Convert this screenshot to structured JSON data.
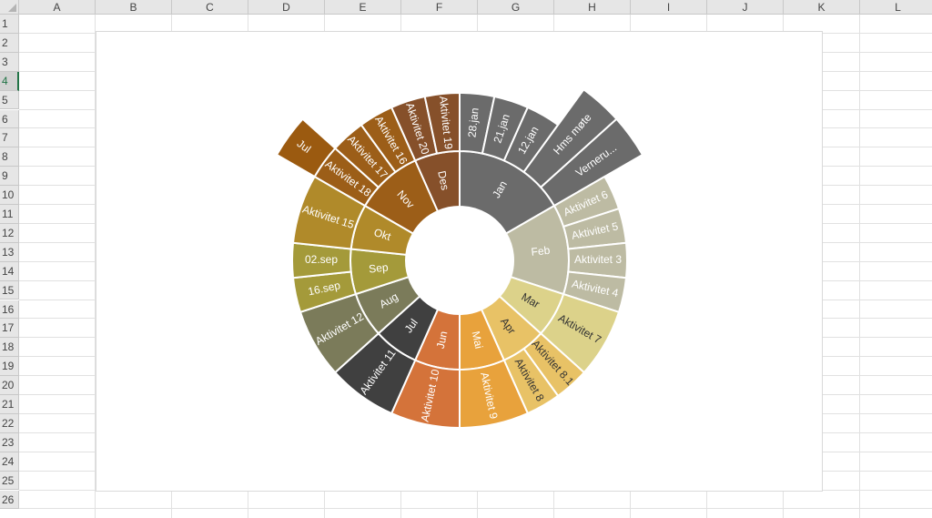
{
  "sheet": {
    "columns": [
      "A",
      "B",
      "C",
      "D",
      "E",
      "F",
      "G",
      "H",
      "I",
      "J",
      "K",
      "L"
    ],
    "rows": [
      "1",
      "2",
      "3",
      "4",
      "5",
      "6",
      "7",
      "8",
      "9",
      "10",
      "11",
      "12",
      "13",
      "14",
      "15",
      "16",
      "17",
      "18",
      "19",
      "20",
      "21",
      "22",
      "23",
      "24",
      "25",
      "26"
    ],
    "selected_row": "4"
  },
  "chart_data": {
    "type": "sunburst",
    "title": "",
    "inner": [
      {
        "label": "Jan",
        "value": 5,
        "color": "#6b6b6b"
      },
      {
        "label": "Feb",
        "value": 4,
        "color": "#bdbba3"
      },
      {
        "label": "Mar",
        "value": 2,
        "color": "#dcd28a"
      },
      {
        "label": "Apr",
        "value": 2,
        "color": "#e8c266"
      },
      {
        "label": "Mai",
        "value": 2,
        "color": "#e8a23c"
      },
      {
        "label": "Jun",
        "value": 2,
        "color": "#d4733a"
      },
      {
        "label": "Jul",
        "value": 2,
        "color": "#404040"
      },
      {
        "label": "Aug",
        "value": 2,
        "color": "#7b7b5a"
      },
      {
        "label": "Sep",
        "value": 2,
        "color": "#a49a3a"
      },
      {
        "label": "Okt",
        "value": 2,
        "color": "#b08a2a"
      },
      {
        "label": "Nov",
        "value": 3,
        "color": "#9c5e18"
      },
      {
        "label": "Des",
        "value": 2,
        "color": "#86502a"
      }
    ],
    "outer": [
      {
        "label": "28.jan",
        "value": 1,
        "color": "#6b6b6b",
        "text": "#ffffff"
      },
      {
        "label": "21.jan",
        "value": 1,
        "color": "#6b6b6b",
        "text": "#ffffff",
        "extended": true
      },
      {
        "label": "12.jan",
        "value": 1,
        "color": "#6b6b6b",
        "text": "#ffffff"
      },
      {
        "label": "Hms møte",
        "value": 1,
        "color": "#6b6b6b",
        "text": "#ffffff",
        "extended": true
      },
      {
        "label": "Verneru...",
        "value": 1,
        "color": "#6b6b6b",
        "text": "#ffffff",
        "extended": true
      },
      {
        "label": "Aktivitet 6",
        "value": 1,
        "color": "#bdbba3",
        "text": "#ffffff"
      },
      {
        "label": "Aktivitet 5",
        "value": 1,
        "color": "#bdbba3",
        "text": "#ffffff"
      },
      {
        "label": "Aktivitet 3",
        "value": 1,
        "color": "#bdbba3",
        "text": "#ffffff"
      },
      {
        "label": "Aktivitet 4",
        "value": 1,
        "color": "#bdbba3",
        "text": "#ffffff"
      },
      {
        "label": "Aktivitet 7",
        "value": 2,
        "color": "#dcd28a",
        "text": "#333333"
      },
      {
        "label": "Aktivitet 8.1",
        "value": 1,
        "color": "#e8c266",
        "text": "#333333"
      },
      {
        "label": "Aktivitet 8",
        "value": 1,
        "color": "#e8c266",
        "text": "#333333"
      },
      {
        "label": "Aktivitet 9",
        "value": 2,
        "color": "#e8a23c",
        "text": "#ffffff"
      },
      {
        "label": "Aktivitet 10",
        "value": 2,
        "color": "#d4733a",
        "text": "#ffffff"
      },
      {
        "label": "Aktivitet 11",
        "value": 2,
        "color": "#404040",
        "text": "#ffffff"
      },
      {
        "label": "Aktivitet 12",
        "value": 2,
        "color": "#7b7b5a",
        "text": "#ffffff"
      },
      {
        "label": "16.sep",
        "value": 1,
        "color": "#a49a3a",
        "text": "#ffffff"
      },
      {
        "label": "02.sep",
        "value": 1,
        "color": "#a49a3a",
        "text": "#ffffff"
      },
      {
        "label": "Aktivitet 15",
        "value": 2,
        "color": "#b08a2a",
        "text": "#ffffff"
      },
      {
        "label": "Aktivitet 18",
        "value": 1,
        "color": "#9c5e18",
        "text": "#ffffff",
        "child": "Jul"
      },
      {
        "label": "Aktivitet 17",
        "value": 1,
        "color": "#9c5e18",
        "text": "#ffffff"
      },
      {
        "label": "Aktivitet 16",
        "value": 1,
        "color": "#9c5e18",
        "text": "#ffffff"
      },
      {
        "label": "Aktivitet 20",
        "value": 1,
        "color": "#86502a",
        "text": "#ffffff"
      },
      {
        "label": "Aktivitet 19",
        "value": 1,
        "color": "#86502a",
        "text": "#ffffff"
      }
    ]
  }
}
